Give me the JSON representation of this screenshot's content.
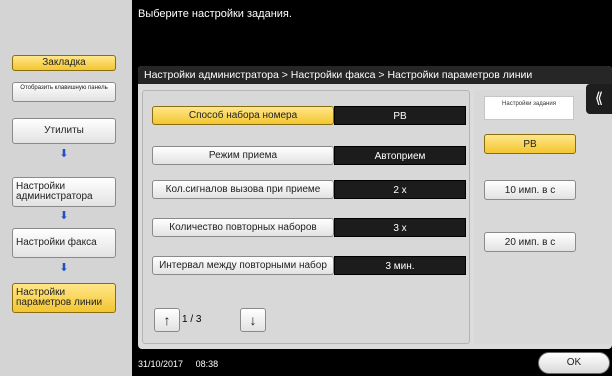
{
  "left_panel": {
    "bookmark": "Закладка",
    "show_keypad": "Отобразить клавишную панель",
    "nav": [
      {
        "label": "Утилиты"
      },
      {
        "label": "Настройки администратора"
      },
      {
        "label": "Настройки факса"
      },
      {
        "label": "Настройки параметров линии"
      }
    ]
  },
  "header": {
    "prompt": "Выберите настройки задания."
  },
  "breadcrumb": "Настройки администратора > Настройки факса > Настройки параметров линии",
  "settings": [
    {
      "label": "Способ набора номера",
      "value": "PB"
    },
    {
      "label": "Режим приема",
      "value": "Автоприем"
    },
    {
      "label": "Кол.сигналов вызова при приеме",
      "value": "2   x"
    },
    {
      "label": "Количество повторных наборов",
      "value": "3   x"
    },
    {
      "label": "Интервал между повторными набор",
      "value": "3   мин."
    }
  ],
  "pager": {
    "current": "1",
    "separator": "/",
    "total": "3"
  },
  "right_panel": {
    "header": "Настройки задания",
    "options": [
      "PB",
      "10 имп. в с",
      "20 имп. в с"
    ]
  },
  "footer": {
    "date": "31/10/2017",
    "time": "08:38",
    "ok": "OK"
  },
  "icons": {
    "back": "double-left-arrow-icon",
    "up": "up-arrow-icon",
    "down": "down-arrow-icon"
  },
  "colors": {
    "selected": "#f3c62f",
    "dark": "#1c1c1c"
  }
}
